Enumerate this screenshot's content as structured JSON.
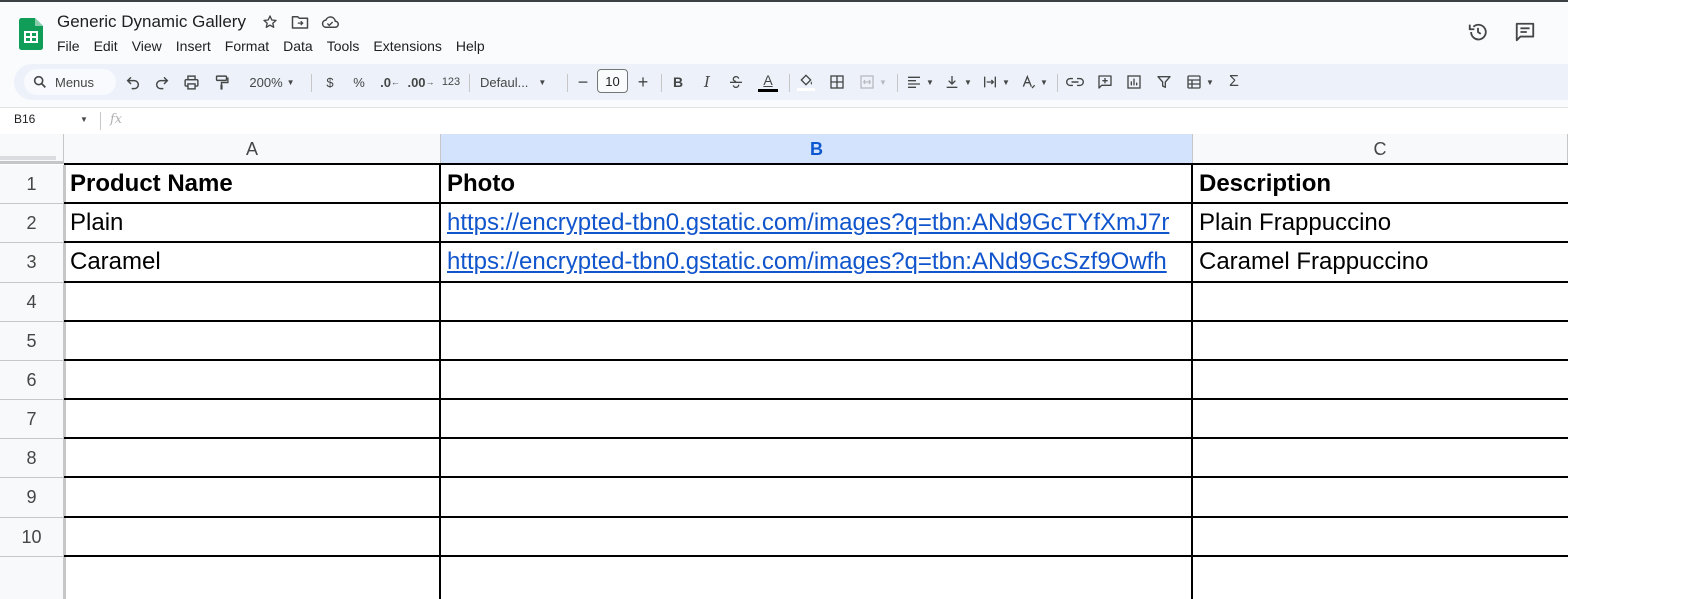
{
  "app": {
    "doc_title": "Generic Dynamic Gallery"
  },
  "menu": [
    "File",
    "Edit",
    "View",
    "Insert",
    "Format",
    "Data",
    "Tools",
    "Extensions",
    "Help"
  ],
  "toolbar": {
    "search_label": "Menus",
    "zoom": "200%",
    "currency": "$",
    "percent": "%",
    "decrease_decimal": ".0",
    "increase_decimal": ".00",
    "more_formats": "123",
    "font": "Defaul...",
    "font_size": "10",
    "bold": "B",
    "italic": "I",
    "text_color": "A"
  },
  "formula_bar": {
    "name_box": "B16",
    "fx": "fx",
    "formula": ""
  },
  "sheet": {
    "selected_column": "B",
    "columns": [
      "A",
      "B",
      "C"
    ],
    "row_numbers": [
      "1",
      "2",
      "3",
      "4",
      "5",
      "6",
      "7",
      "8",
      "9",
      "10"
    ],
    "rows": [
      [
        "Product Name",
        "Photo",
        "Description"
      ],
      [
        "Plain",
        "https://encrypted-tbn0.gstatic.com/images?q=tbn:ANd9GcTYfXmJ7r",
        "Plain Frappuccino"
      ],
      [
        "Caramel",
        "https://encrypted-tbn0.gstatic.com/images?q=tbn:ANd9GcSzf9Owfh",
        "Caramel Frappuccino"
      ],
      [
        "",
        "",
        ""
      ],
      [
        "",
        "",
        ""
      ],
      [
        "",
        "",
        ""
      ],
      [
        "",
        "",
        ""
      ],
      [
        "",
        "",
        ""
      ],
      [
        "",
        "",
        ""
      ],
      [
        "",
        "",
        ""
      ]
    ]
  },
  "colors": {
    "accent": "#0b57d0",
    "link": "#1155cc",
    "selected_header": "#d3e3fd",
    "logo_green": "#0f9d58"
  },
  "icons": [
    "sheets-logo-icon",
    "star-icon",
    "move-folder-icon",
    "cloud-status-icon",
    "version-history-icon",
    "comments-icon",
    "search-icon",
    "undo-icon",
    "redo-icon",
    "print-icon",
    "paint-format-icon",
    "fill-color-icon",
    "borders-icon",
    "merge-cells-icon",
    "align-left-icon",
    "valign-bottom-icon",
    "text-wrap-icon",
    "text-rotate-icon",
    "link-icon",
    "insert-comment-icon",
    "insert-chart-icon",
    "filter-icon",
    "table-view-icon",
    "functions-icon"
  ]
}
